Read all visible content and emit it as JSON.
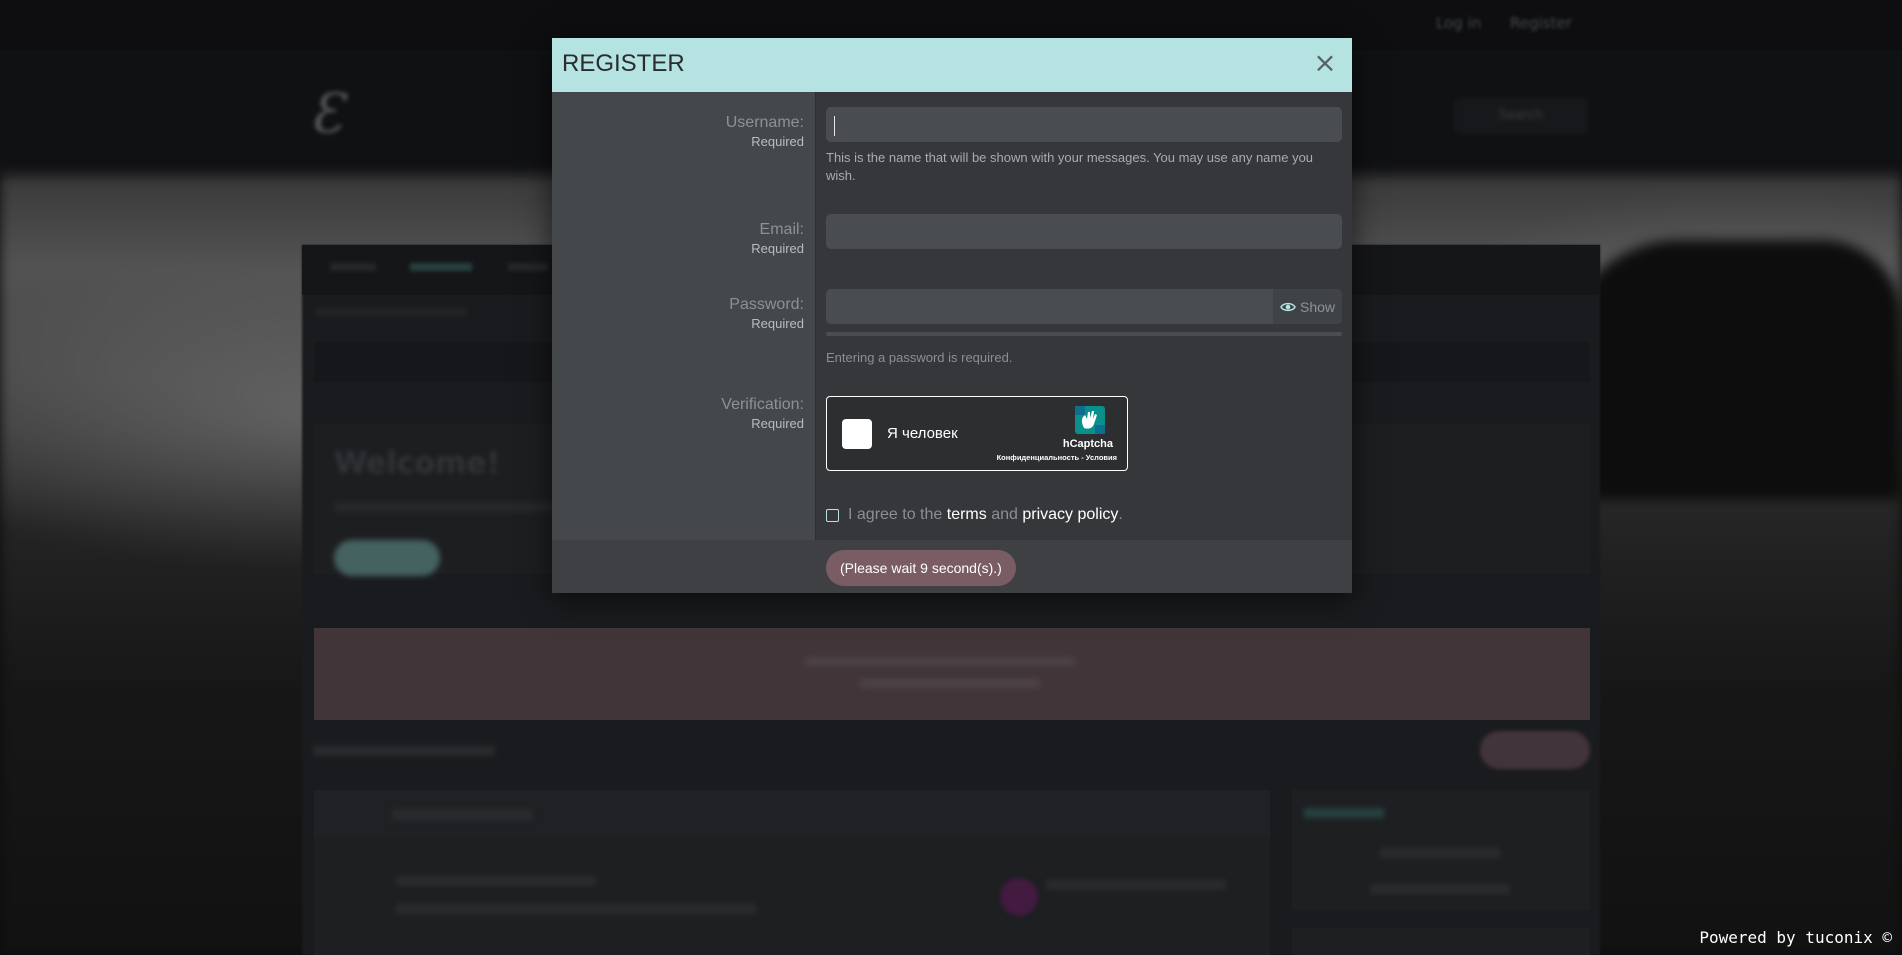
{
  "background": {
    "login": "Log in",
    "register": "Register",
    "search": "Search",
    "welcome": "Welcome!"
  },
  "modal": {
    "title": "REGISTER",
    "close": "×",
    "username": {
      "label": "Username:",
      "required": "Required",
      "value": "",
      "hint": "This is the name that will be shown with your messages. You may use any name you wish."
    },
    "email": {
      "label": "Email:",
      "required": "Required",
      "value": ""
    },
    "password": {
      "label": "Password:",
      "required": "Required",
      "value": "",
      "show": "Show",
      "strength_fraction": 0,
      "hint": "Entering a password is required."
    },
    "verification": {
      "label": "Verification:",
      "required": "Required",
      "captcha_label": "Я человек",
      "captcha_brand": "hCaptcha",
      "captcha_links": "Конфиденциальность - Условия"
    },
    "agree": {
      "prefix": "I agree to the",
      "terms": "terms",
      "and": "and",
      "privacy": "privacy policy",
      "suffix": "."
    },
    "submit": "(Please wait 9 second(s).)"
  },
  "powered_by": "Powered by tuconix ©",
  "colors": {
    "header": "#b4e3e2",
    "submit": "#7a5d64",
    "accent": "#b4e3e2"
  }
}
